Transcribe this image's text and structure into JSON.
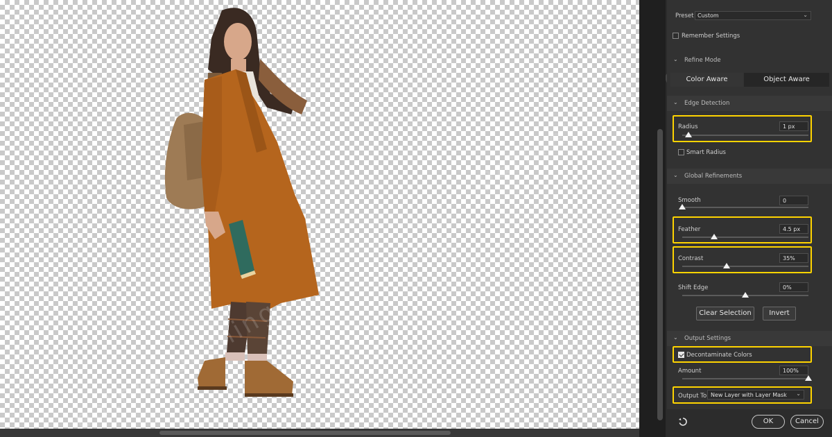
{
  "panel": {
    "preset": {
      "label": "Preset",
      "value": "Custom"
    },
    "remember_settings": {
      "label": "Remember Settings",
      "checked": false
    },
    "refine_mode": {
      "title": "Refine Mode",
      "options": [
        "Color Aware",
        "Object Aware"
      ],
      "selected": "Object Aware"
    },
    "edge_detection": {
      "title": "Edge Detection",
      "radius": {
        "label": "Radius",
        "value": "1 px",
        "level": 0.05
      },
      "smart_radius": {
        "label": "Smart Radius",
        "checked": false
      }
    },
    "global_refinements": {
      "title": "Global Refinements",
      "smooth": {
        "label": "Smooth",
        "value": "0",
        "level": 0.0
      },
      "feather": {
        "label": "Feather",
        "value": "4.5 px",
        "level": 0.25
      },
      "contrast": {
        "label": "Contrast",
        "value": "35%",
        "level": 0.35
      },
      "shift_edge": {
        "label": "Shift Edge",
        "value": "0%",
        "level": 0.5
      },
      "clear_selection_label": "Clear Selection",
      "invert_label": "Invert"
    },
    "output_settings": {
      "title": "Output Settings",
      "decontaminate": {
        "label": "Decontaminate Colors",
        "checked": true
      },
      "amount": {
        "label": "Amount",
        "value": "100%",
        "level": 1.0
      },
      "output_to": {
        "label": "Output To",
        "value": "New Layer with Layer Mask"
      }
    },
    "ok_label": "OK",
    "cancel_label": "Cancel"
  },
  "watermark_text": "pathretouching",
  "colors": {
    "highlight": "#ffd400",
    "coat": "#b5651d",
    "panel_bg": "#323232"
  },
  "icons": {
    "reset": "reset-icon",
    "chevron": "chevron-down-icon"
  }
}
